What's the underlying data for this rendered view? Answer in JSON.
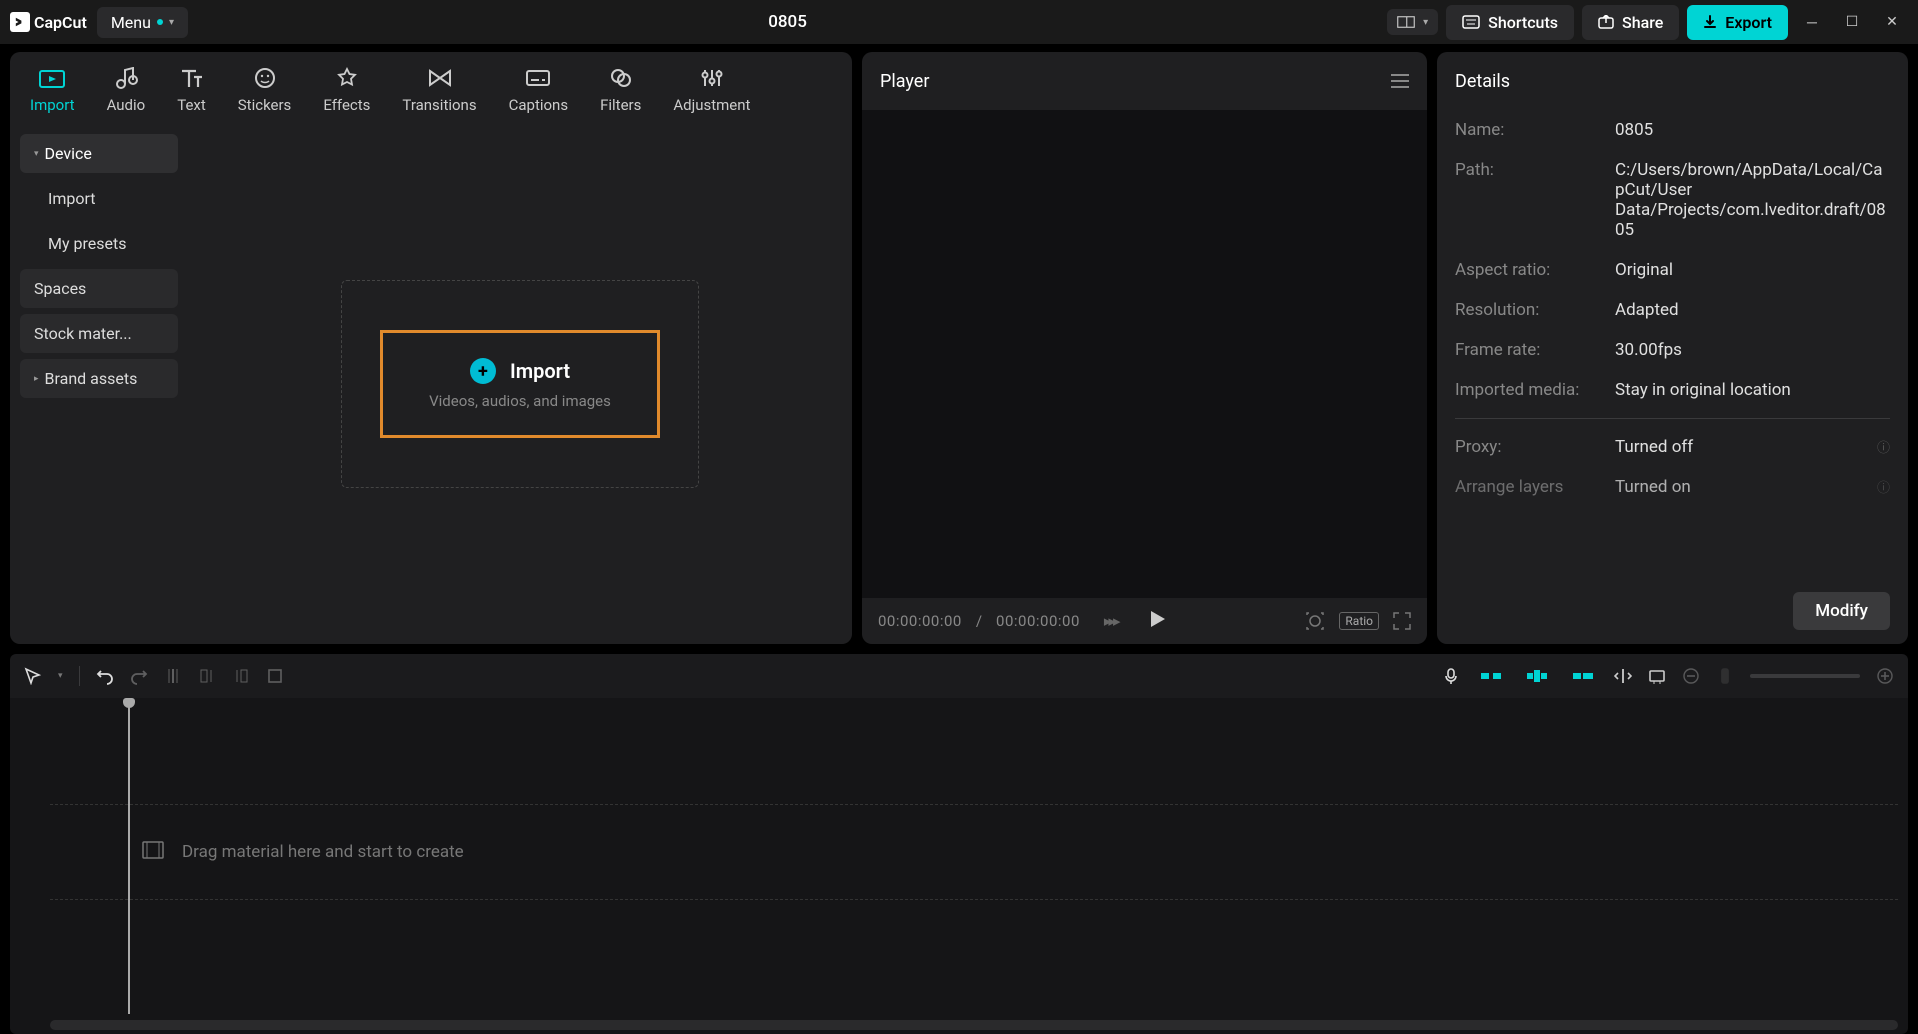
{
  "app": {
    "name": "CapCut",
    "project_title": "0805",
    "menu_label": "Menu"
  },
  "titlebar_buttons": {
    "shortcuts": "Shortcuts",
    "share": "Share",
    "export": "Export"
  },
  "tabs": [
    {
      "id": "import",
      "label": "Import",
      "active": true
    },
    {
      "id": "audio",
      "label": "Audio"
    },
    {
      "id": "text",
      "label": "Text"
    },
    {
      "id": "stickers",
      "label": "Stickers"
    },
    {
      "id": "effects",
      "label": "Effects"
    },
    {
      "id": "transitions",
      "label": "Transitions"
    },
    {
      "id": "captions",
      "label": "Captions"
    },
    {
      "id": "filters",
      "label": "Filters"
    },
    {
      "id": "adjustment",
      "label": "Adjustment"
    }
  ],
  "sidebar": {
    "device": "Device",
    "import": "Import",
    "my_presets": "My presets",
    "spaces": "Spaces",
    "stock": "Stock mater...",
    "brand": "Brand assets"
  },
  "import_box": {
    "title": "Import",
    "subtitle": "Videos, audios, and images"
  },
  "player": {
    "title": "Player",
    "time_current": "00:00:00:00",
    "time_sep": " / ",
    "time_total": "00:00:00:00",
    "ratio_badge": "Ratio"
  },
  "details": {
    "title": "Details",
    "rows": {
      "name_l": "Name:",
      "name_v": "0805",
      "path_l": "Path:",
      "path_v": "C:/Users/brown/AppData/Local/CapCut/User Data/Projects/com.lveditor.draft/0805",
      "aspect_l": "Aspect ratio:",
      "aspect_v": "Original",
      "res_l": "Resolution:",
      "res_v": "Adapted",
      "fps_l": "Frame rate:",
      "fps_v": "30.00fps",
      "impmedia_l": "Imported media:",
      "impmedia_v": "Stay in original location",
      "proxy_l": "Proxy:",
      "proxy_v": "Turned off",
      "layers_l": "Arrange layers",
      "layers_v": "Turned on"
    },
    "modify": "Modify"
  },
  "timeline": {
    "drop_hint": "Drag material here and start to create"
  }
}
